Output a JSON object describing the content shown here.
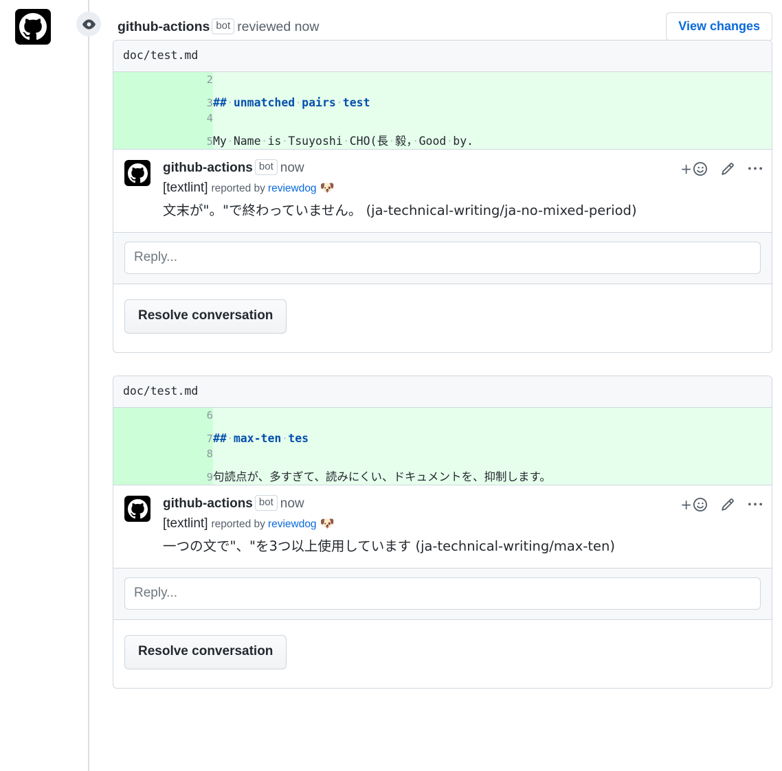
{
  "timeline": {
    "event_icon": "eye-icon",
    "actor": "github-actions",
    "bot_badge": "bot",
    "action_text": "reviewed now",
    "view_changes_label": "View changes",
    "avatar_icon": "github-octocat-icon"
  },
  "threads": [
    {
      "file": "doc/test.md",
      "diff": [
        {
          "lineno": "2",
          "segments": []
        },
        {
          "lineno": "3",
          "segments": [
            {
              "text": "##",
              "style": "md-head"
            },
            {
              "text": "·",
              "style": "ws"
            },
            {
              "text": "unmatched",
              "style": "md-head"
            },
            {
              "text": "·",
              "style": "ws"
            },
            {
              "text": "pairs",
              "style": "md-head"
            },
            {
              "text": "·",
              "style": "ws"
            },
            {
              "text": "test",
              "style": "md-head"
            }
          ]
        },
        {
          "lineno": "4",
          "segments": []
        },
        {
          "lineno": "5",
          "segments": [
            {
              "text": "My",
              "style": "plain"
            },
            {
              "text": "·",
              "style": "ws"
            },
            {
              "text": "Name",
              "style": "plain"
            },
            {
              "text": "·",
              "style": "ws"
            },
            {
              "text": "is",
              "style": "plain"
            },
            {
              "text": "·",
              "style": "ws"
            },
            {
              "text": "Tsuyoshi",
              "style": "plain"
            },
            {
              "text": "·",
              "style": "ws"
            },
            {
              "text": "CHO(長",
              "style": "plain"
            },
            {
              "text": "·",
              "style": "ws"
            },
            {
              "text": "毅，",
              "style": "plain"
            },
            {
              "text": "·",
              "style": "ws"
            },
            {
              "text": "Good",
              "style": "plain"
            },
            {
              "text": "·",
              "style": "ws"
            },
            {
              "text": "by.",
              "style": "plain"
            }
          ]
        }
      ],
      "comment": {
        "avatar_icon": "github-octocat-icon",
        "actor": "github-actions",
        "bot_badge": "bot",
        "timestamp": "now",
        "tool_tag": "[textlint]",
        "reported_by": "reported by",
        "reporter_link": "reviewdog",
        "reporter_emoji": "🐶",
        "message": "文末が\"。\"で終わっていません。  (ja-technical-writing/ja-no-mixed-period)",
        "actions": [
          {
            "name": "add-reaction-icon",
            "label": "+"
          },
          {
            "name": "edit-icon",
            "label": ""
          },
          {
            "name": "more-options-icon",
            "label": ""
          }
        ]
      },
      "reply_placeholder": "Reply...",
      "resolve_label": "Resolve conversation"
    },
    {
      "file": "doc/test.md",
      "diff": [
        {
          "lineno": "6",
          "segments": []
        },
        {
          "lineno": "7",
          "segments": [
            {
              "text": "##",
              "style": "md-head"
            },
            {
              "text": "·",
              "style": "ws"
            },
            {
              "text": "max-ten",
              "style": "md-head"
            },
            {
              "text": "·",
              "style": "ws"
            },
            {
              "text": "tes",
              "style": "md-head"
            }
          ]
        },
        {
          "lineno": "8",
          "segments": []
        },
        {
          "lineno": "9",
          "segments": [
            {
              "text": "句読点が、多すぎて、読みにくい、ドキュメントを、抑制します。",
              "style": "jp"
            }
          ]
        }
      ],
      "comment": {
        "avatar_icon": "github-octocat-icon",
        "actor": "github-actions",
        "bot_badge": "bot",
        "timestamp": "now",
        "tool_tag": "[textlint]",
        "reported_by": "reported by",
        "reporter_link": "reviewdog",
        "reporter_emoji": "🐶",
        "message": "一つの文で\"、\"を3つ以上使用しています (ja-technical-writing/max-ten)",
        "actions": [
          {
            "name": "add-reaction-icon",
            "label": "+"
          },
          {
            "name": "edit-icon",
            "label": ""
          },
          {
            "name": "more-options-icon",
            "label": ""
          }
        ]
      },
      "reply_placeholder": "Reply...",
      "resolve_label": "Resolve conversation"
    }
  ],
  "colors": {
    "diff_add_bg": "#e6ffec",
    "diff_add_gutter": "#ccffd8",
    "link_blue": "#0969da",
    "border": "#d0d7de",
    "muted": "#57606a"
  }
}
